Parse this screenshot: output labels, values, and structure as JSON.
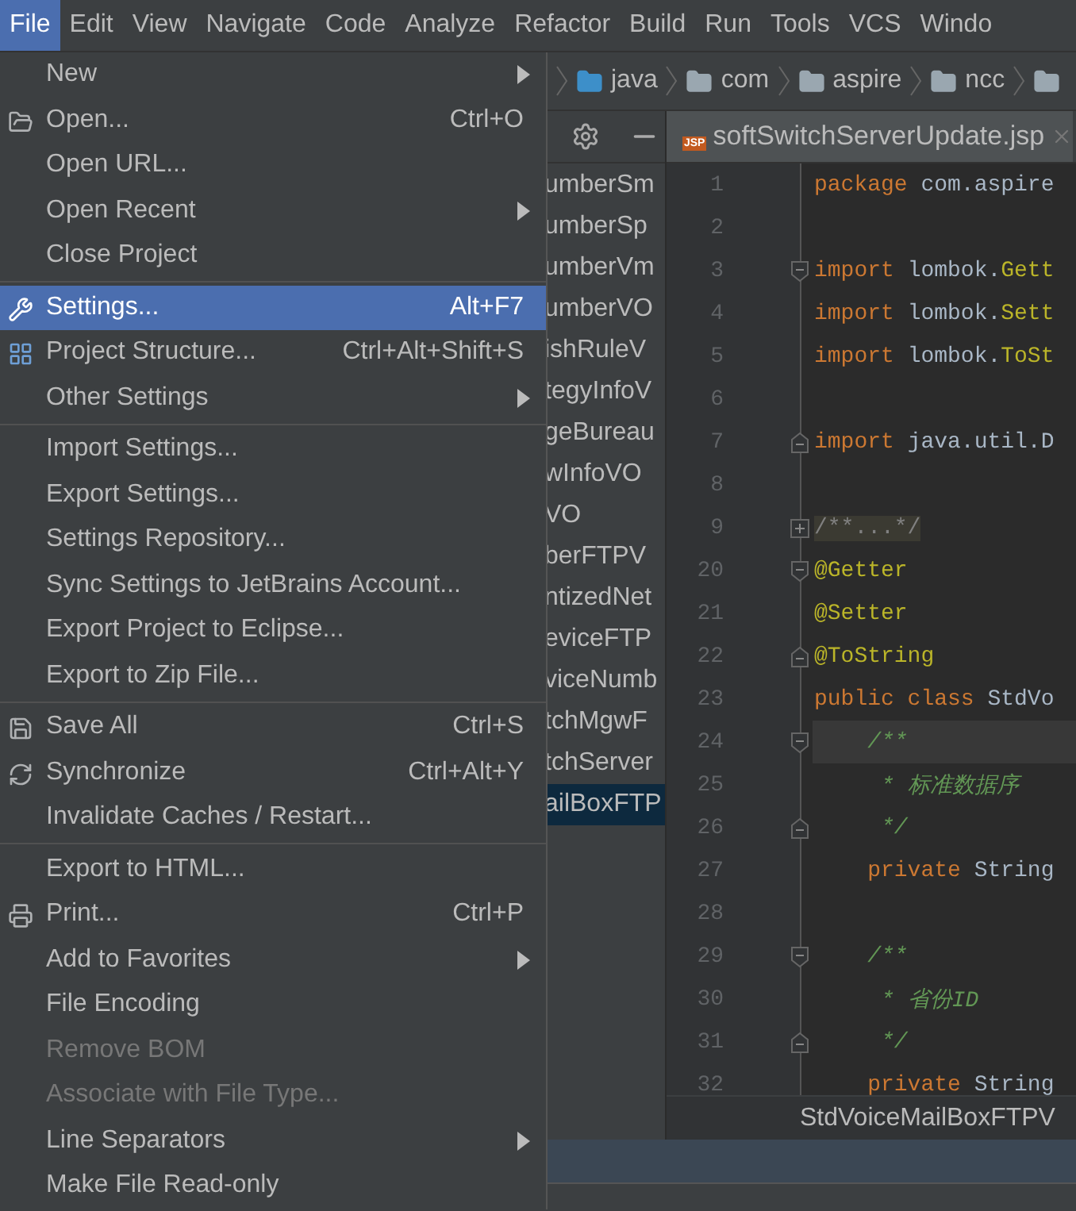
{
  "menubar": [
    {
      "label": "File",
      "selected": true
    },
    {
      "label": "Edit",
      "selected": false
    },
    {
      "label": "View",
      "selected": false
    },
    {
      "label": "Navigate",
      "selected": false
    },
    {
      "label": "Code",
      "selected": false
    },
    {
      "label": "Analyze",
      "selected": false
    },
    {
      "label": "Refactor",
      "selected": false
    },
    {
      "label": "Build",
      "selected": false
    },
    {
      "label": "Run",
      "selected": false
    },
    {
      "label": "Tools",
      "selected": false
    },
    {
      "label": "VCS",
      "selected": false
    },
    {
      "label": "Windo",
      "selected": false
    }
  ],
  "file_menu": [
    {
      "kind": "item",
      "label": "New",
      "submenu": true,
      "selected": false,
      "disabled": false
    },
    {
      "kind": "item",
      "label": "Open...",
      "shortcut": "Ctrl+O",
      "selected": false,
      "disabled": false
    },
    {
      "kind": "item",
      "label": "Open URL...",
      "selected": false,
      "disabled": false
    },
    {
      "kind": "item",
      "label": "Open Recent",
      "submenu": true,
      "selected": false,
      "disabled": false
    },
    {
      "kind": "item",
      "label": "Close Project",
      "selected": false,
      "disabled": false
    },
    {
      "kind": "separator"
    },
    {
      "kind": "item",
      "label": "Settings...",
      "shortcut": "Alt+F7",
      "selected": true,
      "disabled": false
    },
    {
      "kind": "item",
      "label": "Project Structure...",
      "shortcut": "Ctrl+Alt+Shift+S",
      "selected": false,
      "disabled": false
    },
    {
      "kind": "item",
      "label": "Other Settings",
      "submenu": true,
      "selected": false,
      "disabled": false
    },
    {
      "kind": "separator"
    },
    {
      "kind": "item",
      "label": "Import Settings...",
      "selected": false,
      "disabled": false
    },
    {
      "kind": "item",
      "label": "Export Settings...",
      "selected": false,
      "disabled": false
    },
    {
      "kind": "item",
      "label": "Settings Repository...",
      "selected": false,
      "disabled": false
    },
    {
      "kind": "item",
      "label": "Sync Settings to JetBrains Account...",
      "selected": false,
      "disabled": false
    },
    {
      "kind": "item",
      "label": "Export Project to Eclipse...",
      "selected": false,
      "disabled": false
    },
    {
      "kind": "item",
      "label": "Export to Zip File...",
      "selected": false,
      "disabled": false
    },
    {
      "kind": "separator"
    },
    {
      "kind": "item",
      "label": "Save All",
      "shortcut": "Ctrl+S",
      "selected": false,
      "disabled": false
    },
    {
      "kind": "item",
      "label": "Synchronize",
      "shortcut": "Ctrl+Alt+Y",
      "selected": false,
      "disabled": false
    },
    {
      "kind": "item",
      "label": "Invalidate Caches / Restart...",
      "selected": false,
      "disabled": false
    },
    {
      "kind": "separator"
    },
    {
      "kind": "item",
      "label": "Export to HTML...",
      "selected": false,
      "disabled": false
    },
    {
      "kind": "item",
      "label": "Print...",
      "shortcut": "Ctrl+P",
      "selected": false,
      "disabled": false
    },
    {
      "kind": "item",
      "label": "Add to Favorites",
      "submenu": true,
      "selected": false,
      "disabled": false
    },
    {
      "kind": "item",
      "label": "File Encoding",
      "selected": false,
      "disabled": false
    },
    {
      "kind": "item",
      "label": "Remove BOM",
      "selected": false,
      "disabled": true
    },
    {
      "kind": "item",
      "label": "Associate with File Type...",
      "selected": false,
      "disabled": true
    },
    {
      "kind": "item",
      "label": "Line Separators",
      "submenu": true,
      "selected": false,
      "disabled": false
    },
    {
      "kind": "item",
      "label": "Make File Read-only",
      "selected": false,
      "disabled": false
    }
  ],
  "breadcrumb": [
    {
      "kind": "source",
      "label": "java"
    },
    {
      "kind": "package",
      "label": "com"
    },
    {
      "kind": "package",
      "label": "aspire"
    },
    {
      "kind": "package",
      "label": "ncc"
    },
    {
      "kind": "package"
    }
  ],
  "project_files": [
    {
      "label": "umberSm",
      "selected": false
    },
    {
      "label": "umberSp",
      "selected": false
    },
    {
      "label": "umberVm",
      "selected": false
    },
    {
      "label": "umberVO",
      "selected": false
    },
    {
      "label": "ishRuleV",
      "selected": false
    },
    {
      "label": "tegyInfoV",
      "selected": false
    },
    {
      "label": "geBureau",
      "selected": false
    },
    {
      "label": "wInfoVO",
      "selected": false
    },
    {
      "label": "VO",
      "selected": false
    },
    {
      "label": "berFTPV",
      "selected": false
    },
    {
      "label": "ntizedNet",
      "selected": false
    },
    {
      "label": "eviceFTP",
      "selected": false
    },
    {
      "label": "viceNumb",
      "selected": false
    },
    {
      "label": "tchMgwF",
      "selected": false
    },
    {
      "label": "tchServer",
      "selected": false
    },
    {
      "label": "ailBoxFTP",
      "selected": true
    }
  ],
  "editor_tab": {
    "label": "softSwitchServerUpdate.jsp",
    "icon_label": "JSP"
  },
  "code_lines": [
    {
      "number": "1",
      "tokens": [
        {
          "kind": "keyword",
          "text": "package "
        },
        {
          "kind": "plain",
          "text": "com.aspire"
        }
      ]
    },
    {
      "number": "2"
    },
    {
      "number": "3",
      "fold_start": true,
      "tokens": [
        {
          "kind": "keyword",
          "text": "import "
        },
        {
          "kind": "plain",
          "text": "lombok."
        },
        {
          "kind": "annotation",
          "text": "Gett"
        }
      ]
    },
    {
      "number": "4",
      "tokens": [
        {
          "kind": "keyword",
          "text": "import "
        },
        {
          "kind": "plain",
          "text": "lombok."
        },
        {
          "kind": "annotation",
          "text": "Sett"
        }
      ]
    },
    {
      "number": "5",
      "tokens": [
        {
          "kind": "keyword",
          "text": "import "
        },
        {
          "kind": "plain",
          "text": "lombok."
        },
        {
          "kind": "annotation",
          "text": "ToSt"
        }
      ]
    },
    {
      "number": "6"
    },
    {
      "number": "7",
      "fold_end": true,
      "tokens": [
        {
          "kind": "keyword",
          "text": "import "
        },
        {
          "kind": "plain",
          "text": "java.util.D"
        }
      ]
    },
    {
      "number": "8"
    },
    {
      "number": "9",
      "collapsed": true,
      "tokens": [
        {
          "kind": "folded",
          "text": "/**...*/"
        }
      ]
    },
    {
      "number": "20",
      "fold_start": true,
      "tokens": [
        {
          "kind": "annotation",
          "text": "@Getter"
        }
      ]
    },
    {
      "number": "21",
      "tokens": [
        {
          "kind": "annotation",
          "text": "@Setter"
        }
      ]
    },
    {
      "number": "22",
      "fold_end": true,
      "tokens": [
        {
          "kind": "annotation",
          "text": "@ToString"
        }
      ]
    },
    {
      "number": "23",
      "tokens": [
        {
          "kind": "keyword",
          "text": "public class "
        },
        {
          "kind": "plain",
          "text": "StdVo"
        }
      ]
    },
    {
      "number": "24",
      "fold_start": true,
      "current": true,
      "tokens": [
        {
          "kind": "comment",
          "text": "    /**"
        }
      ]
    },
    {
      "number": "25",
      "tokens": [
        {
          "kind": "comment",
          "text": "     * 标准数据序"
        }
      ]
    },
    {
      "number": "26",
      "fold_end": true,
      "tokens": [
        {
          "kind": "comment",
          "text": "     */"
        }
      ]
    },
    {
      "number": "27",
      "tokens": [
        {
          "kind": "keyword",
          "text": "    private "
        },
        {
          "kind": "plain",
          "text": "String"
        }
      ]
    },
    {
      "number": "28"
    },
    {
      "number": "29",
      "fold_start": true,
      "tokens": [
        {
          "kind": "comment",
          "text": "    /**"
        }
      ]
    },
    {
      "number": "30",
      "tokens": [
        {
          "kind": "comment",
          "text": "     * 省份ID"
        }
      ]
    },
    {
      "number": "31",
      "fold_end": true,
      "tokens": [
        {
          "kind": "comment",
          "text": "     */"
        }
      ]
    },
    {
      "number": "32",
      "tokens": [
        {
          "kind": "keyword",
          "text": "    private "
        },
        {
          "kind": "plain",
          "text": "String"
        }
      ]
    }
  ],
  "editor_breadcrumb": "StdVoiceMailBoxFTPV"
}
